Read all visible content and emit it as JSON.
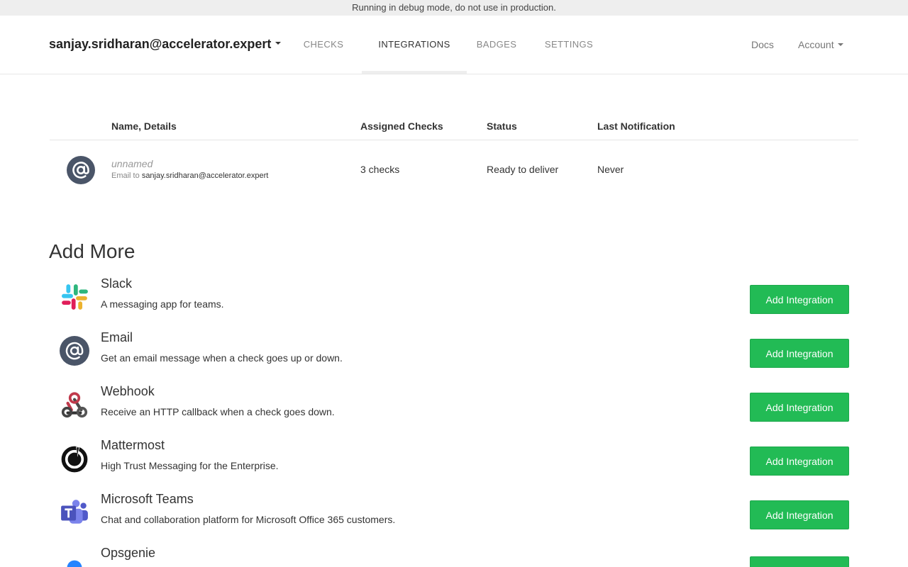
{
  "debug_banner": "Running in debug mode, do not use in production.",
  "navbar": {
    "project": "sanjay.sridharan@accelerator.expert",
    "tabs": [
      {
        "label": "CHECKS",
        "active": false
      },
      {
        "label": "INTEGRATIONS",
        "active": true
      },
      {
        "label": "BADGES",
        "active": false
      },
      {
        "label": "SETTINGS",
        "active": false
      }
    ],
    "docs": "Docs",
    "account": "Account"
  },
  "integrations_table": {
    "headers": [
      "Name, Details",
      "Assigned Checks",
      "Status",
      "Last Notification"
    ],
    "rows": [
      {
        "icon": "email-icon",
        "name": "unnamed",
        "detail_prefix": "Email to",
        "detail_value": "sanjay.sridharan@accelerator.expert",
        "assigned_checks": "3 checks",
        "status": "Ready to deliver",
        "last_notification": "Never"
      }
    ]
  },
  "add_more": {
    "title": "Add More",
    "button_label": "Add Integration",
    "items": [
      {
        "icon": "slack-icon",
        "title": "Slack",
        "description": "A messaging app for teams."
      },
      {
        "icon": "email-icon",
        "title": "Email",
        "description": "Get an email message when a check goes up or down."
      },
      {
        "icon": "webhook-icon",
        "title": "Webhook",
        "description": "Receive an HTTP callback when a check goes down."
      },
      {
        "icon": "mattermost-icon",
        "title": "Mattermost",
        "description": "High Trust Messaging for the Enterprise."
      },
      {
        "icon": "microsoft-teams-icon",
        "title": "Microsoft Teams",
        "description": "Chat and collaboration platform for Microsoft Office 365 customers."
      },
      {
        "icon": "opsgenie-icon",
        "title": "Opsgenie",
        "description": ""
      }
    ]
  },
  "colors": {
    "button_green": "#22bb55",
    "email_icon_bg": "#4a5568",
    "banner_bg": "#eeeeee"
  }
}
